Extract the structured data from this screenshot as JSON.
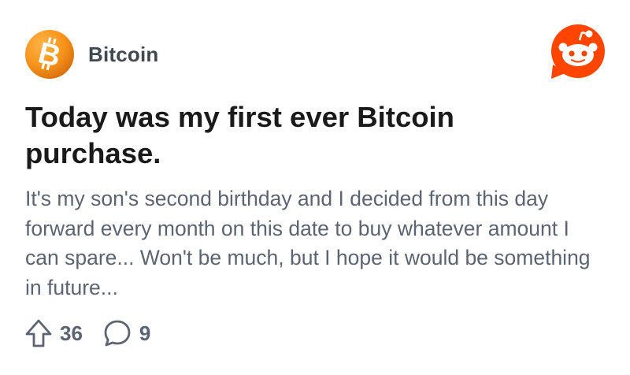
{
  "post": {
    "community": {
      "name": "Bitcoin",
      "icon": "bitcoin-logo-icon",
      "icon_color": "#f7931a"
    },
    "brand": {
      "icon": "reddit-snoo-icon",
      "color": "#ff4500"
    },
    "title": "Today was my first ever Bitcoin purchase.",
    "body": "It's my son's second birthday and I decided from this day forward every month on this date to buy whatever amount I can spare... Won't be much, but I hope it would be something in future...",
    "upvotes": {
      "icon": "upvote-arrow-icon",
      "count": "36"
    },
    "comments": {
      "icon": "comment-bubble-icon",
      "count": "9"
    }
  }
}
